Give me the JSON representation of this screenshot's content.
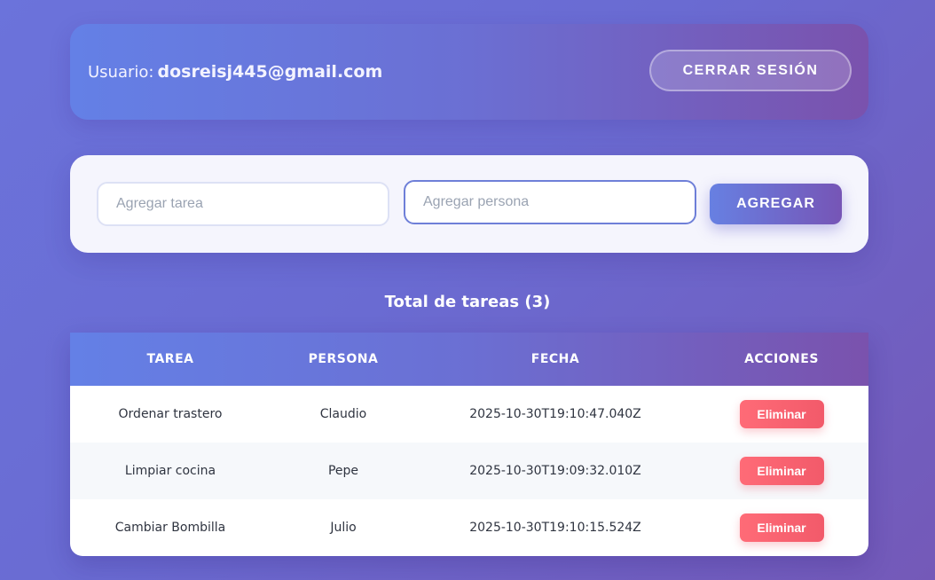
{
  "header": {
    "user_prefix": "Usuario:",
    "user_email": "dosreisj445@gmail.com",
    "logout_label": "CERRAR SESIÓN"
  },
  "form": {
    "task_placeholder": "Agregar tarea",
    "task_value": "",
    "person_placeholder": "Agregar persona",
    "person_value": "",
    "add_label": "AGREGAR"
  },
  "list": {
    "title": "Total de tareas (3)",
    "columns": [
      "TAREA",
      "PERSONA",
      "FECHA",
      "ACCIONES"
    ],
    "rows": [
      {
        "task": "Ordenar trastero",
        "person": "Claudio",
        "date": "2025-10-30T19:10:47.040Z",
        "action": "Eliminar"
      },
      {
        "task": "Limpiar cocina",
        "person": "Pepe",
        "date": "2025-10-30T19:09:32.010Z",
        "action": "Eliminar"
      },
      {
        "task": "Cambiar Bombilla",
        "person": "Julio",
        "date": "2025-10-30T19:10:15.524Z",
        "action": "Eliminar"
      }
    ]
  },
  "colors": {
    "accent_start": "#6480e6",
    "accent_end": "#7a52ad",
    "danger": "#f25a6a"
  }
}
